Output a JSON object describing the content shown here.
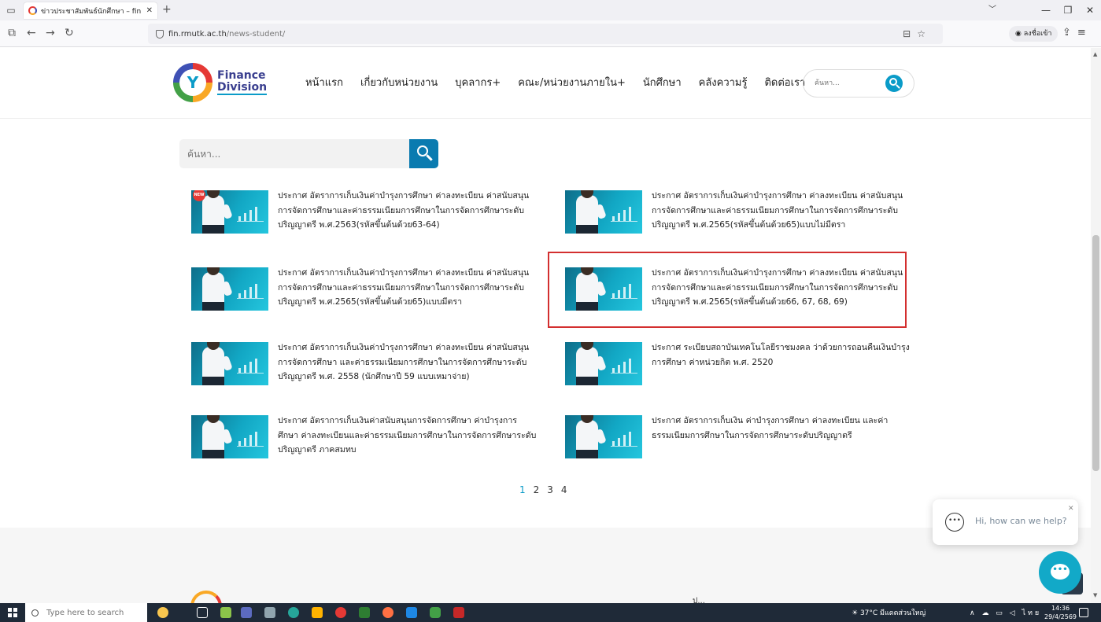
{
  "browser": {
    "tab_title": "ข่าวประชาสัมพันธ์นักศึกษา – fin",
    "url_domain": "fin.rmutk.ac.th",
    "url_path": "/news-student/",
    "signin_label": "ลงชื่อเข้า"
  },
  "site": {
    "logo_line1": "Finance",
    "logo_line2": "Division",
    "menu": [
      "หน้าแรก",
      "เกี่ยวกับหน่วยงาน",
      "บุคลากร+",
      "คณะ/หน่วยงานภายใน+",
      "นักศึกษา",
      "คลังความรู้",
      "ติดต่อเรา"
    ],
    "header_search_placeholder": "ค้นหา..."
  },
  "main": {
    "search_placeholder": "ค้นหา...",
    "new_badge": "NEW",
    "news": [
      {
        "title": "ประกาศ อัตราการเก็บเงินค่าบำรุงการศึกษา ค่าลงทะเบียน ค่าสนับสนุนการจัดการศึกษาและค่าธรรมเนียมการศึกษาในการจัดการศึกษาระดับปริญญาตรี พ.ศ.2563(รหัสขึ้นต้นด้วย63-64)",
        "is_new": true
      },
      {
        "title": "ประกาศ อัตราการเก็บเงินค่าบำรุงการศึกษา ค่าลงทะเบียน ค่าสนับสนุนการจัดการศึกษาและค่าธรรมเนียมการศึกษาในการจัดการศึกษาระดับปริญญาตรี พ.ศ.2565(รหัสขึ้นต้นด้วย65)แบบไม่มีตรา",
        "is_new": false
      },
      {
        "title": "ประกาศ อัตราการเก็บเงินค่าบำรุงการศึกษา ค่าลงทะเบียน ค่าสนับสนุนการจัดการศึกษาและค่าธรรมเนียมการศึกษาในการจัดการศึกษาระดับปริญญาตรี พ.ศ.2565(รหัสขึ้นต้นด้วย65)แบบมีตรา",
        "is_new": false
      },
      {
        "title": "ประกาศ อัตราการเก็บเงินค่าบำรุงการศึกษา ค่าลงทะเบียน ค่าสนับสนุนการจัดการศึกษาและค่าธรรมเนียมการศึกษาในการจัดการศึกษาระดับปริญญาตรี พ.ศ.2565(รหัสขึ้นต้นด้วย66, 67, 68, 69)",
        "is_new": false,
        "highlighted": true
      },
      {
        "title": "ประกาศ อัตราการเก็บเงินค่าบำรุงการศึกษา ค่าลงทะเบียน ค่าสนับสนุนการจัดการศึกษา และค่าธรรมเนียมการศึกษาในการจัดการศึกษาระดับปริญญาตรี พ.ศ. 2558 (นักศึกษาปี 59 แบบเหมาจ่าย)",
        "is_new": false
      },
      {
        "title": "ประกาศ ระเบียบสถาบันเทคโนโลยีราชมงคล ว่าด้วยการถอนคืนเงินบำรุงการศึกษา ค่าหน่วยกิต พ.ศ. 2520",
        "is_new": false
      },
      {
        "title": "ประกาศ อัตราการเก็บเงินค่าสนับสนุนการจัดการศึกษา ค่าบำรุงการศึกษา ค่าลงทะเบียนและค่าธรรมเนียมการศึกษาในการจัดการศึกษาระดับปริญญาตรี ภาคสมทบ",
        "is_new": false
      },
      {
        "title": "ประกาศ อัตราการเก็บเงิน ค่าบำรุงการศึกษา ค่าลงทะเบียน และค่าธรรมเนียมการศึกษาในการจัดการศึกษาระดับปริญญาตรี",
        "is_new": false
      }
    ],
    "pages": [
      "1",
      "2",
      "3",
      "4"
    ],
    "current_page": "1"
  },
  "footer": {
    "partial_text": "ป..."
  },
  "chat": {
    "greeting": "Hi, how can we help?"
  },
  "taskbar": {
    "search_placeholder": "Type here to search",
    "weather": "37°C มีแดดส่วนใหญ่",
    "lang": "ไทย",
    "time": "14:36",
    "date": "29/4/2569"
  },
  "colors": {
    "accent": "#0a9bc8",
    "highlight": "#d32f2f",
    "brand_navy": "#3a3f8f"
  }
}
